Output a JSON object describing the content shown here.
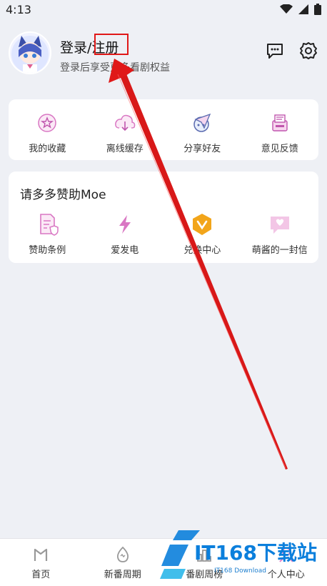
{
  "status_bar": {
    "time": "4:13"
  },
  "header": {
    "login_title": "登录/注册",
    "login_subtitle": "登录后享受更多看剧权益"
  },
  "quick_actions": [
    {
      "label": "我的收藏",
      "icon": "favorite-icon"
    },
    {
      "label": "离线缓存",
      "icon": "cloud-download-icon"
    },
    {
      "label": "分享好友",
      "icon": "share-icon"
    },
    {
      "label": "意见反馈",
      "icon": "feedback-icon"
    }
  ],
  "sponsor": {
    "title": "请多多赞助Moe",
    "items": [
      {
        "label": "赞助条例",
        "icon": "document-icon"
      },
      {
        "label": "爱发电",
        "icon": "lightning-icon"
      },
      {
        "label": "兑换中心",
        "icon": "badge-icon"
      },
      {
        "label": "萌酱的一封信",
        "icon": "letter-icon"
      }
    ]
  },
  "bottom_nav": [
    {
      "label": "首页",
      "icon": "home-icon"
    },
    {
      "label": "新番周期",
      "icon": "egg-icon"
    },
    {
      "label": "番剧周榜",
      "icon": "ranking-icon"
    },
    {
      "label": "个人中心",
      "icon": "profile-icon"
    }
  ],
  "watermark": {
    "brand": "IT168下载站",
    "sub": "IT168 Download"
  },
  "colors": {
    "accent_pink": "#e080c8",
    "highlight_red": "#e01818",
    "badge_gold": "#f2a51a"
  }
}
